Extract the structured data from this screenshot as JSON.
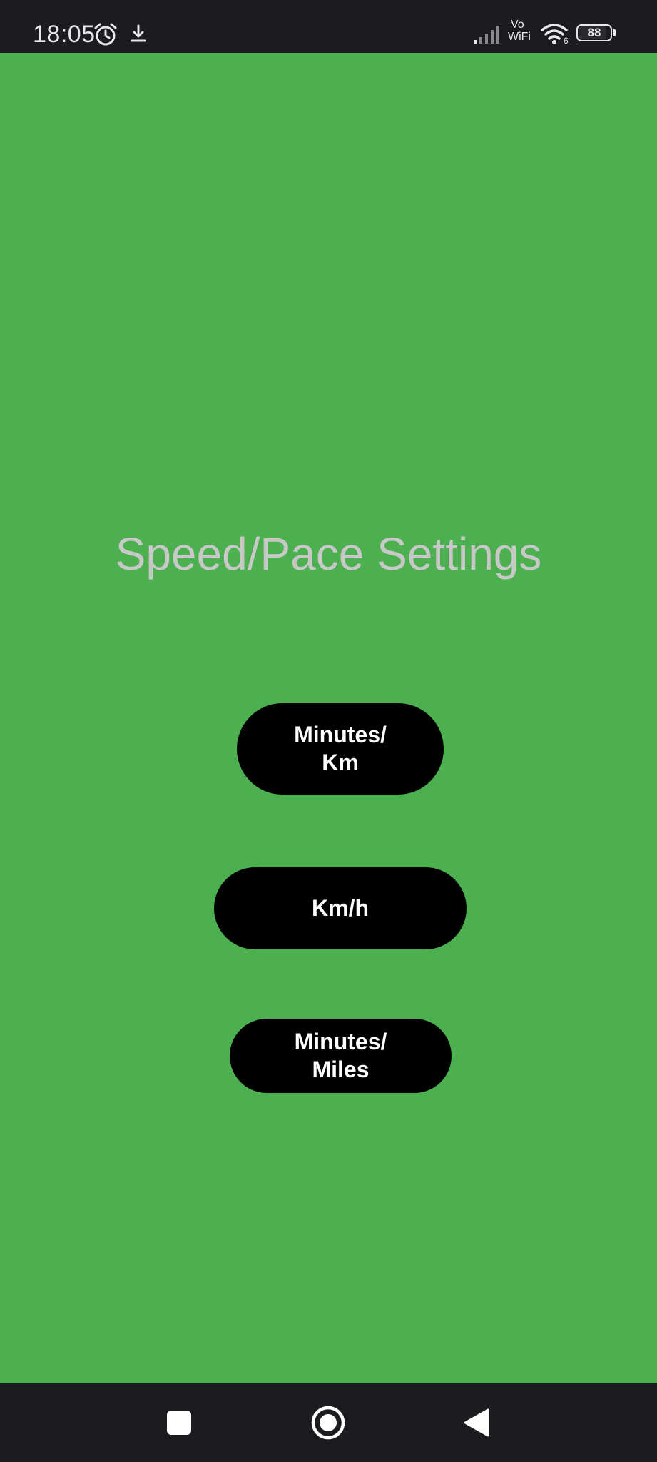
{
  "status_bar": {
    "time": "18:05",
    "battery_level": "88",
    "battery_fraction": 0.88,
    "network_label_top": "Vo",
    "network_label_bottom": "WiFi",
    "wifi_badge": "6",
    "icons": [
      "alarm-icon",
      "download-icon",
      "signal-icon",
      "vowifi-icon",
      "wifi-icon",
      "battery-icon"
    ]
  },
  "main": {
    "title": "Speed/Pace Settings",
    "buttons": [
      {
        "label": "Minutes/\nKm"
      },
      {
        "label": "Km/h"
      },
      {
        "label": "Minutes/\nMiles"
      }
    ]
  },
  "nav_bar": {
    "icons": [
      "recents-icon",
      "home-icon",
      "back-icon"
    ]
  },
  "colors": {
    "background": "#4caf50",
    "title_text": "#c8c8c8",
    "button_bg": "#000000",
    "button_text": "#ffffff",
    "system_bars": "#1c1b20"
  }
}
